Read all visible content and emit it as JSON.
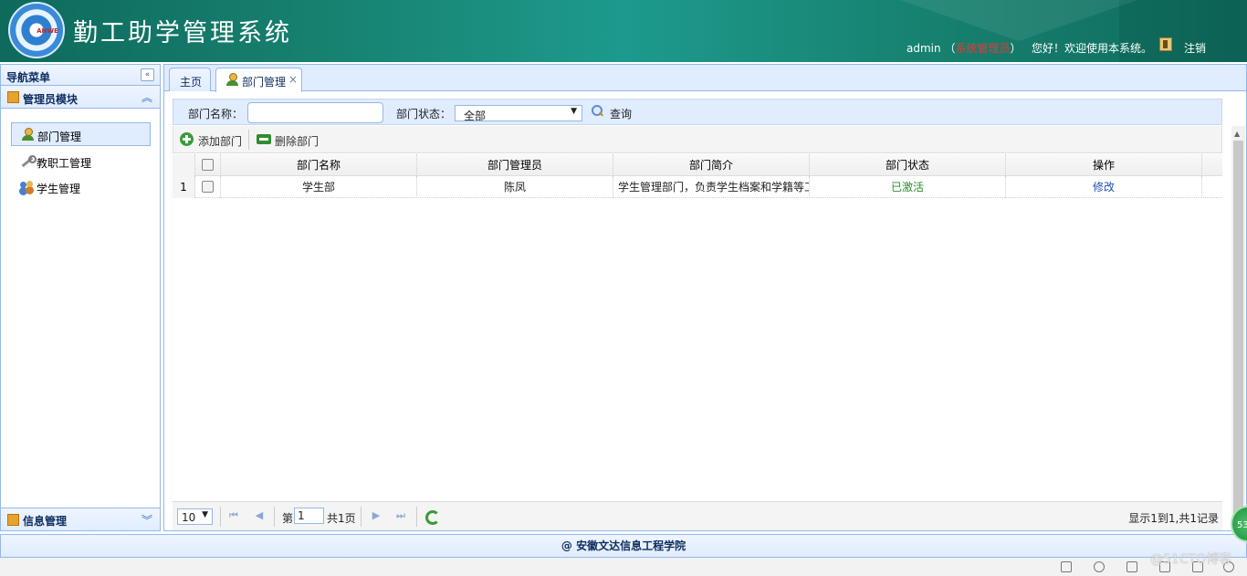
{
  "header": {
    "app_title": "勤工助学管理系统",
    "logo_text": "AHWE",
    "username": "admin",
    "role": "系统管理员",
    "role_open": "（",
    "role_close": "）",
    "welcome": "您好！欢迎使用本系统。",
    "logout_label": "注销"
  },
  "nav": {
    "title": "导航菜单",
    "collapse_glyph": "«",
    "section_admin": "管理员模块",
    "section_info": "信息管理",
    "items": [
      {
        "label": "部门管理",
        "icon": "user-icon",
        "active": true
      },
      {
        "label": "教职工管理",
        "icon": "wrench-icon",
        "active": false
      },
      {
        "label": "学生管理",
        "icon": "users-icon",
        "active": false
      }
    ]
  },
  "tabs": {
    "home": "主页",
    "dept": "部门管理",
    "close": "×"
  },
  "search": {
    "name_label": "部门名称：",
    "name_value": "",
    "status_label": "部门状态：",
    "status_selected": "全部",
    "query_label": "查询"
  },
  "toolbar": {
    "add_label": "添加部门",
    "delete_label": "删除部门"
  },
  "grid": {
    "columns": [
      "部门名称",
      "部门管理员",
      "部门简介",
      "部门状态",
      "操作"
    ],
    "rows": [
      {
        "num": "1",
        "name": "学生部",
        "manager": "陈凤",
        "desc": "学生管理部门，负责学生档案和学籍等工",
        "status": "已激活",
        "action": "修改"
      }
    ]
  },
  "pager": {
    "page_size": "10",
    "page_prefix": "第",
    "page_value": "1",
    "total_pages": "共1页",
    "summary": "显示1到1,共1记录"
  },
  "footer": {
    "text": "@ 安徽文达信息工程学院"
  },
  "overlay": {
    "watermark": "@51CTO博客",
    "badge": "53"
  },
  "colors": {
    "header_teal": "#17806f",
    "panel_blue": "#e0ecff",
    "border_blue": "#95b8e7",
    "role_red": "#e53935",
    "status_green": "#2e8b2e"
  }
}
